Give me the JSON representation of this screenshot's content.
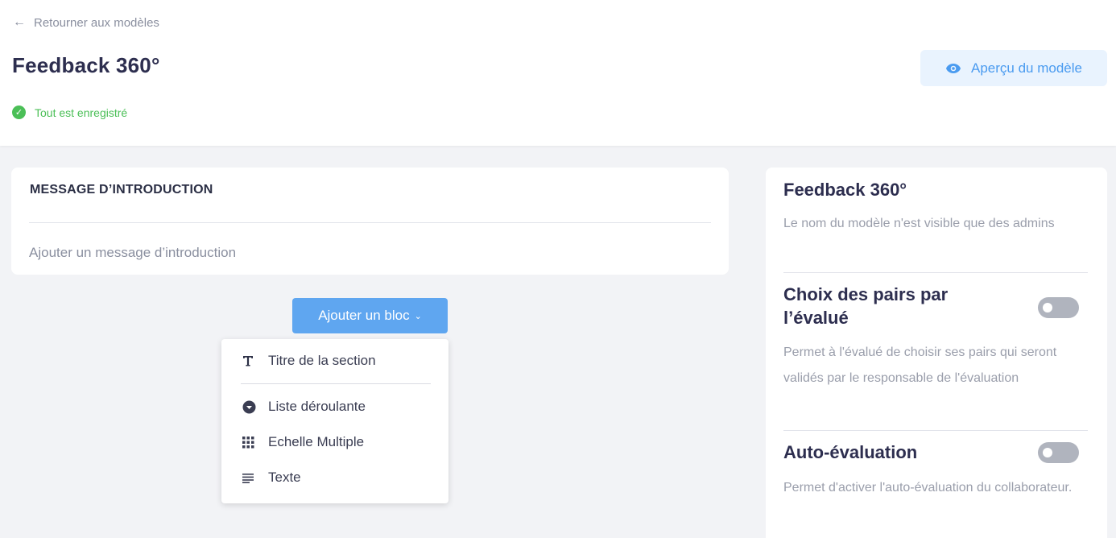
{
  "header": {
    "back_label": "Retourner aux modèles",
    "title": "Feedback 360°",
    "saved_status": "Tout est enregistré",
    "preview_label": "Aperçu du modèle"
  },
  "intro": {
    "title": "MESSAGE D’INTRODUCTION",
    "placeholder": "Ajouter un message d’introduction"
  },
  "add_block": {
    "label": "Ajouter un bloc",
    "menu": [
      {
        "label": "Titre de la section",
        "icon": "text-t-icon"
      },
      {
        "label": "Liste déroulante",
        "icon": "dropdown-circle-icon"
      },
      {
        "label": "Echelle Multiple",
        "icon": "grid-icon"
      },
      {
        "label": "Texte",
        "icon": "text-lines-icon"
      }
    ]
  },
  "sidebar": {
    "title": "Feedback 360°",
    "title_desc": "Le nom du modèle n'est visible que des admins",
    "peers": {
      "label": "Choix des pairs par l’évalué",
      "desc": "Permet à l'évalué de choisir ses pairs qui seront validés par le responsable de l'évaluation",
      "enabled": false
    },
    "self_eval": {
      "label": "Auto-évaluation",
      "desc": "Permet d'activer l'auto-évaluation du collaborateur.",
      "enabled": false
    }
  },
  "colors": {
    "accent": "#5fa6f0",
    "success": "#4bbf57",
    "title": "#2d2e4f",
    "muted": "#8a8f9f"
  }
}
